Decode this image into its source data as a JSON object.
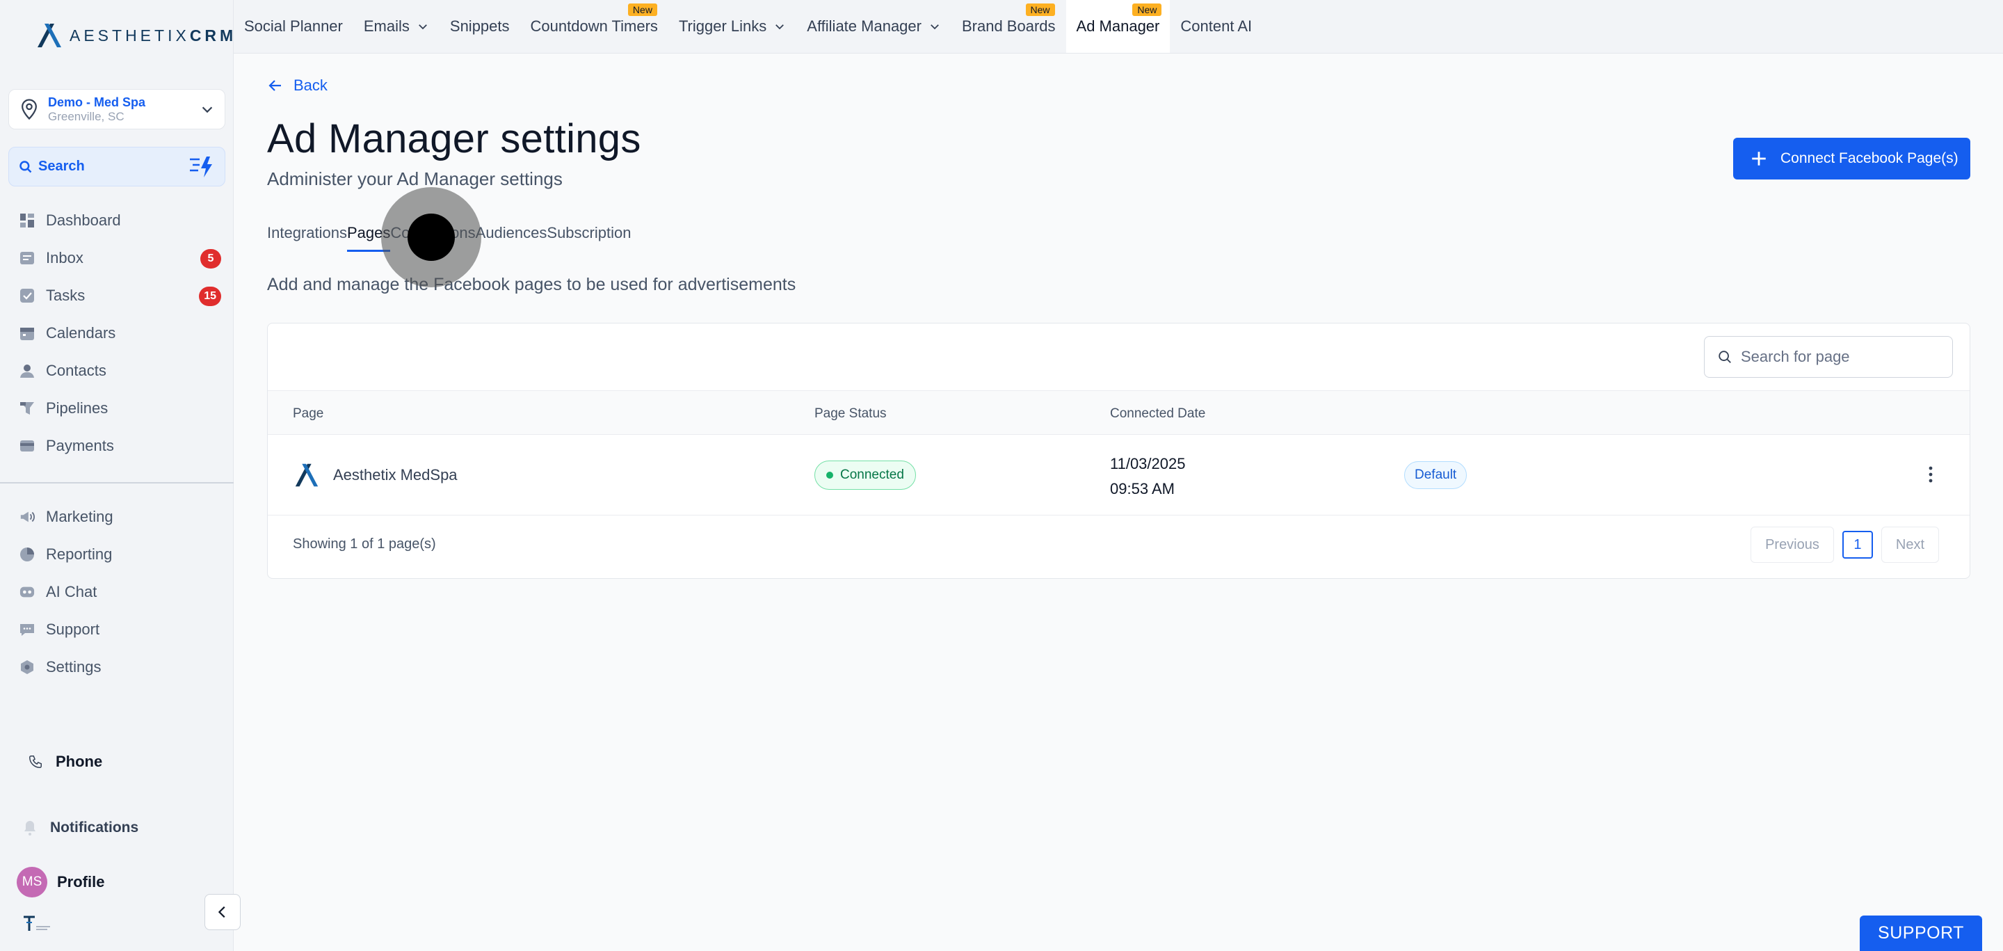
{
  "brand": {
    "logo_text_a": "AESTHETIX",
    "logo_text_b": "CRM"
  },
  "location": {
    "name": "Demo - Med Spa",
    "city": "Greenville, SC"
  },
  "sidebar": {
    "search_label": "Search",
    "items": [
      {
        "label": "Dashboard",
        "icon": "dashboard-icon"
      },
      {
        "label": "Inbox",
        "icon": "inbox-icon",
        "badge": "5"
      },
      {
        "label": "Tasks",
        "icon": "tasks-icon",
        "badge": "15"
      },
      {
        "label": "Calendars",
        "icon": "calendar-icon"
      },
      {
        "label": "Contacts",
        "icon": "contacts-icon"
      },
      {
        "label": "Pipelines",
        "icon": "pipelines-icon"
      },
      {
        "label": "Payments",
        "icon": "payments-icon"
      }
    ],
    "items2": [
      {
        "label": "Marketing",
        "icon": "marketing-icon"
      },
      {
        "label": "Reporting",
        "icon": "reporting-icon"
      },
      {
        "label": "AI Chat",
        "icon": "ai-chat-icon"
      },
      {
        "label": "Support",
        "icon": "support-icon"
      },
      {
        "label": "Settings",
        "icon": "settings-icon"
      }
    ],
    "phone_label": "Phone",
    "notifications_label": "Notifications",
    "profile_label": "Profile",
    "avatar_initials": "MS"
  },
  "topnav": [
    {
      "label": "Social Planner"
    },
    {
      "label": "Emails",
      "dropdown": true
    },
    {
      "label": "Snippets"
    },
    {
      "label": "Countdown Timers",
      "tag": "New"
    },
    {
      "label": "Trigger Links",
      "dropdown": true
    },
    {
      "label": "Affiliate Manager",
      "dropdown": true
    },
    {
      "label": "Brand Boards",
      "tag": "New"
    },
    {
      "label": "Ad Manager",
      "tag": "New",
      "active": true
    },
    {
      "label": "Content AI"
    }
  ],
  "main": {
    "back_label": "Back",
    "title": "Ad Manager settings",
    "subtitle": "Administer your Ad Manager settings",
    "connect_button": "Connect Facebook Page(s)",
    "tabs": [
      {
        "label": "Integrations"
      },
      {
        "label": "Pages",
        "active": true
      },
      {
        "label": "Conversions"
      },
      {
        "label": "Audiences"
      },
      {
        "label": "Subscription"
      }
    ],
    "description": "Add and manage the Facebook pages to be used for advertisements"
  },
  "table": {
    "search_placeholder": "Search for page",
    "columns": {
      "page": "Page",
      "status": "Page Status",
      "date": "Connected Date"
    },
    "rows": [
      {
        "page": "Aesthetix MedSpa",
        "status": "Connected",
        "date": "11/03/2025",
        "time": "09:53 AM",
        "tag": "Default"
      }
    ],
    "footer": "Showing 1 of 1 page(s)",
    "pager": {
      "previous": "Previous",
      "current": "1",
      "next": "Next"
    }
  },
  "support_button": "SUPPORT",
  "colors": {
    "accent": "#155eef",
    "badge": "#e02d2d",
    "connected": "#17b26a",
    "new_tag": "#fdb022"
  }
}
